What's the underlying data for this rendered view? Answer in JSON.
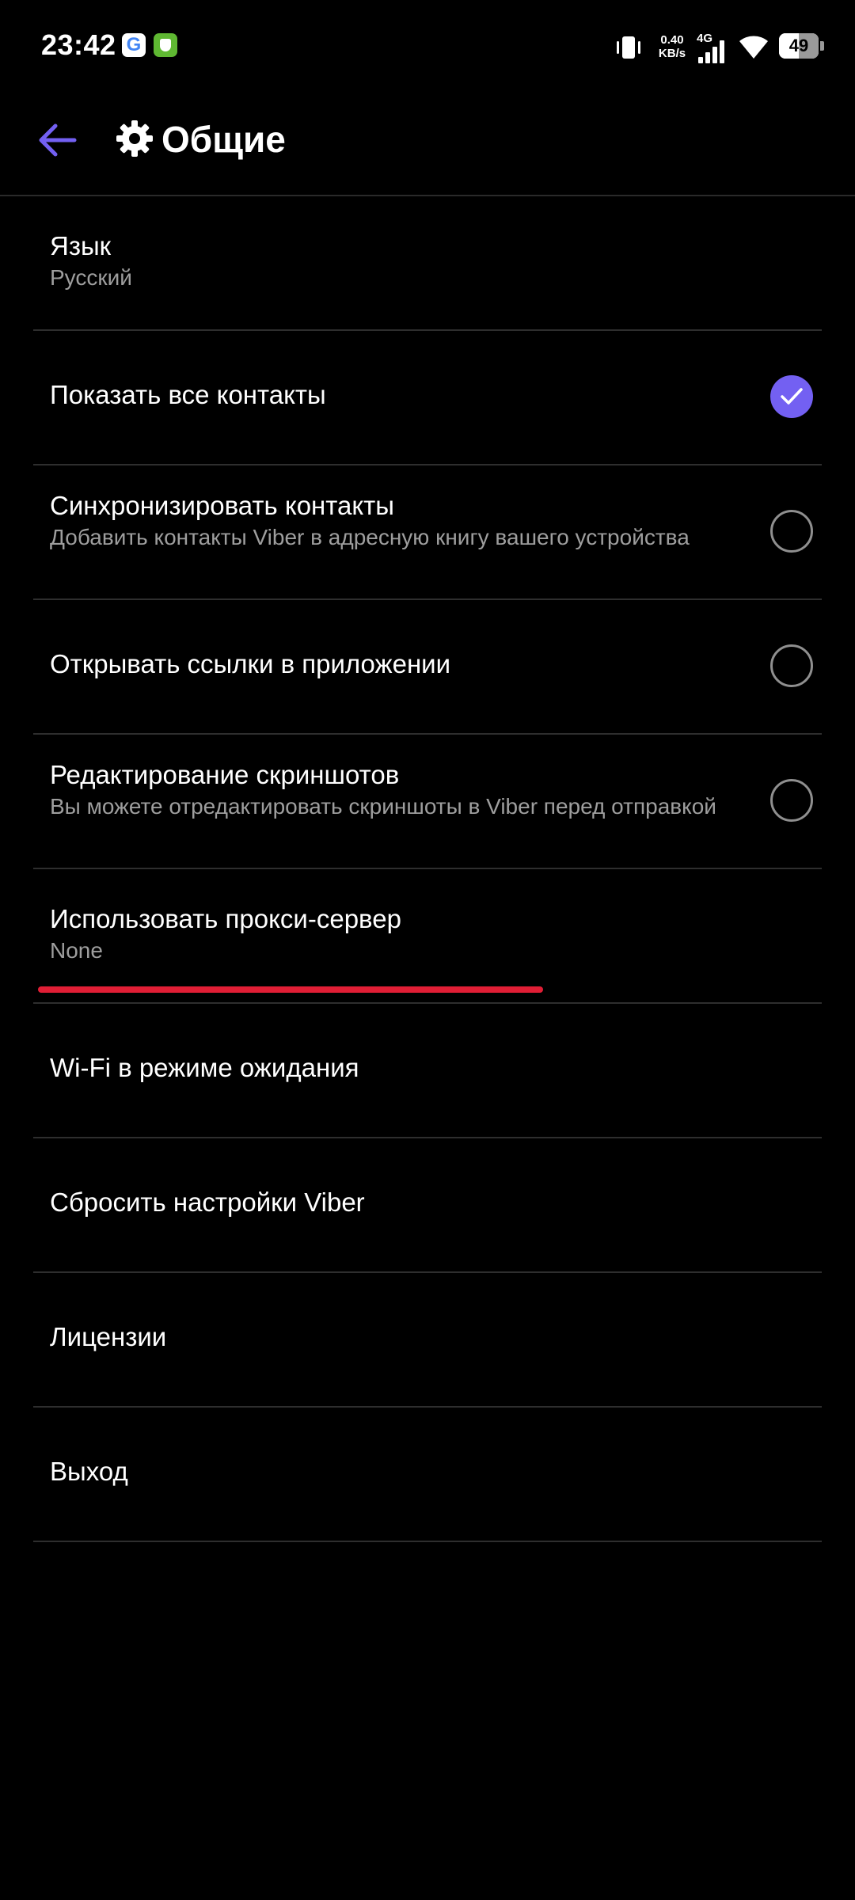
{
  "status_bar": {
    "time": "23:42",
    "app_icons": [
      "google-icon",
      "shield-app-icon"
    ],
    "net_speed_value": "0.40",
    "net_speed_unit": "KB/s",
    "network": "4G",
    "battery": "49",
    "battery_level": 0.49
  },
  "toolbar": {
    "title": "Общие",
    "accent_color": "#7360f2"
  },
  "settings": [
    {
      "title": "Язык",
      "subtitle": "Русский",
      "control": "none"
    },
    {
      "title": "Показать все контакты",
      "subtitle": "",
      "control": "checkbox",
      "checked": true
    },
    {
      "title": "Синхронизировать контакты",
      "subtitle": "Добавить контакты Viber в адресную книгу вашего устройства",
      "control": "checkbox",
      "checked": false
    },
    {
      "title": "Открывать ссылки в приложении",
      "subtitle": "",
      "control": "checkbox",
      "checked": false
    },
    {
      "title": "Редактирование скриншотов",
      "subtitle": "Вы можете отредактировать скриншоты в Viber перед отправкой",
      "control": "checkbox",
      "checked": false
    },
    {
      "title": "Использовать прокси-сервер",
      "subtitle": "None",
      "control": "none"
    },
    {
      "title": "Wi-Fi в режиме ожидания",
      "subtitle": "",
      "control": "none"
    },
    {
      "title": "Сбросить настройки Viber",
      "subtitle": "",
      "control": "none"
    },
    {
      "title": "Лицензии",
      "subtitle": "",
      "control": "none"
    },
    {
      "title": "Выход",
      "subtitle": "",
      "control": "none"
    }
  ],
  "highlight_color": "#e01e35"
}
